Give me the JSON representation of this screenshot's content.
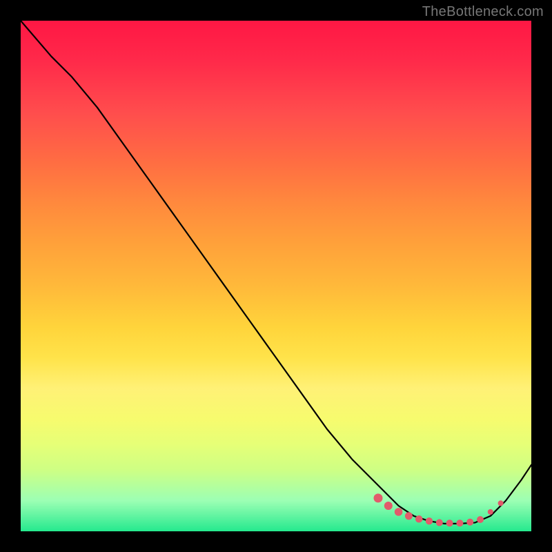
{
  "watermark": "TheBottleneck.com",
  "palette": {
    "frame": "#000000",
    "curve": "#000000",
    "markers": "#e15b6b"
  },
  "chart_data": {
    "type": "line",
    "title": "",
    "xlabel": "",
    "ylabel": "",
    "xlim": [
      0,
      100
    ],
    "ylim": [
      0,
      100
    ],
    "grid": false,
    "legend_position": "none",
    "series": [
      {
        "name": "bottleneck_curve",
        "x": [
          0,
          6,
          10,
          15,
          20,
          25,
          30,
          35,
          40,
          45,
          50,
          55,
          60,
          65,
          70,
          74,
          77,
          80,
          83,
          86,
          89,
          92,
          95,
          98,
          100
        ],
        "values": [
          100,
          93,
          89,
          83,
          76,
          69,
          62,
          55,
          48,
          41,
          34,
          27,
          20,
          14,
          9,
          5,
          3,
          2,
          1.5,
          1.5,
          1.7,
          3,
          6,
          10,
          13
        ]
      }
    ],
    "markers": {
      "name": "highlighted_range",
      "x": [
        70,
        72,
        74,
        76,
        78,
        80,
        82,
        84,
        86,
        88,
        90,
        92,
        94
      ],
      "values": [
        6.5,
        5.0,
        3.8,
        3.0,
        2.4,
        2.0,
        1.7,
        1.6,
        1.6,
        1.8,
        2.3,
        3.8,
        5.5
      ],
      "radius": [
        6.5,
        6.0,
        5.8,
        5.5,
        5.3,
        5.2,
        5.0,
        5.0,
        5.0,
        5.0,
        5.0,
        4.0,
        4.0
      ]
    },
    "annotations": []
  }
}
